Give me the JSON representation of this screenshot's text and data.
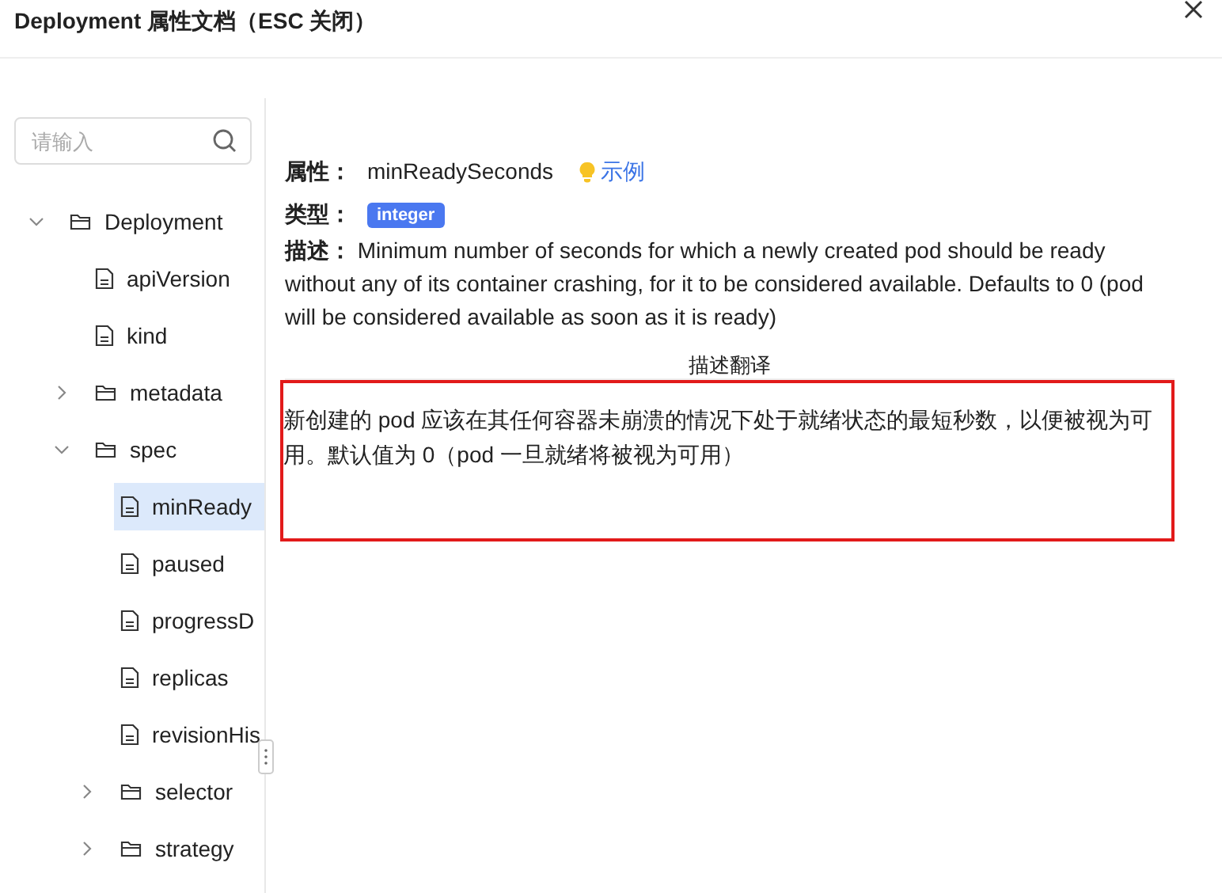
{
  "window": {
    "title": "Deployment 属性文档（ESC 关闭）"
  },
  "search": {
    "placeholder": "请输入"
  },
  "tree": [
    {
      "label": "Deployment",
      "kind": "folder",
      "expanded": true,
      "selected": false,
      "children": [
        {
          "label": "apiVersion",
          "kind": "file",
          "selected": false
        },
        {
          "label": "kind",
          "kind": "file",
          "selected": false
        },
        {
          "label": "metadata",
          "kind": "folder",
          "expanded": false,
          "selected": false
        },
        {
          "label": "spec",
          "kind": "folder",
          "expanded": true,
          "selected": false,
          "children": [
            {
              "label": "minReady",
              "kind": "file",
              "selected": true
            },
            {
              "label": "paused",
              "kind": "file",
              "selected": false
            },
            {
              "label": "progressD",
              "kind": "file",
              "selected": false
            },
            {
              "label": "replicas",
              "kind": "file",
              "selected": false
            },
            {
              "label": "revisionHis",
              "kind": "file",
              "selected": false
            },
            {
              "label": "selector",
              "kind": "folder",
              "expanded": false,
              "selected": false
            },
            {
              "label": "strategy",
              "kind": "folder",
              "expanded": false,
              "selected": false
            }
          ]
        }
      ]
    }
  ],
  "detail": {
    "property_label": "属性：",
    "property": "minReadySeconds",
    "example_link": "示例",
    "type_label": "类型：",
    "type": "integer",
    "description": "**描述：** Minimum number of seconds for which a newly created pod should be ready without any of its container crashing, for it to be considered available. Defaults to 0 (pod will be considered available as soon as it is ready)",
    "translation_title": "描述翻译",
    "translation": "新创建的 pod 应该在其任何容器未崩溃的情况下处于就绪状态的最短秒数，以便被视为可用。默认值为 0（pod 一旦就绪将被视为可用）"
  }
}
